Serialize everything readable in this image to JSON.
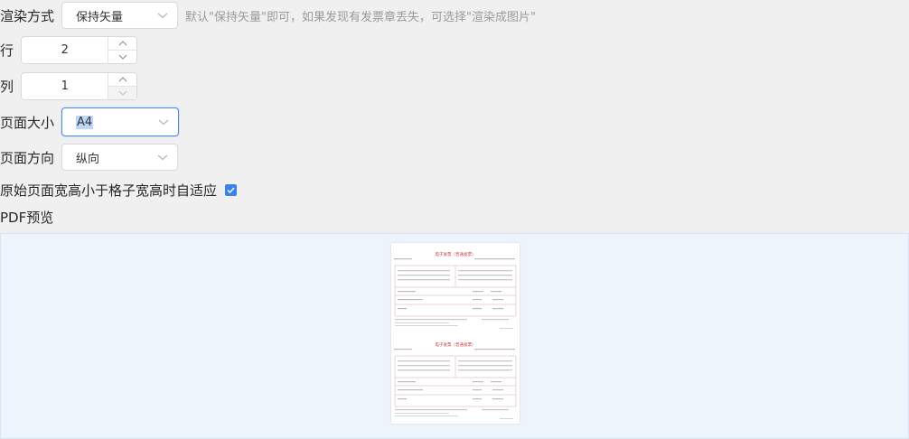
{
  "render_mode": {
    "label": "渲染方式",
    "value": "保持矢量",
    "hint": "默认\"保持矢量\"即可，如果发现有发票章丢失，可选择\"渲染成图片\""
  },
  "rows": {
    "label": "行",
    "value": "2"
  },
  "cols": {
    "label": "列",
    "value": "1"
  },
  "page_size": {
    "label": "页面大小",
    "value": "A4"
  },
  "orientation": {
    "label": "页面方向",
    "value": "纵向"
  },
  "auto_fit": {
    "label": "原始页面宽高小于格子宽高时自适应",
    "checked": true
  },
  "preview": {
    "title": "PDF预览",
    "invoice_heading": "电子发票（普通发票）"
  },
  "colors": {
    "accent": "#3b82e6",
    "focus_border": "#4a8fe0",
    "preview_bg": "#edf4fc"
  }
}
